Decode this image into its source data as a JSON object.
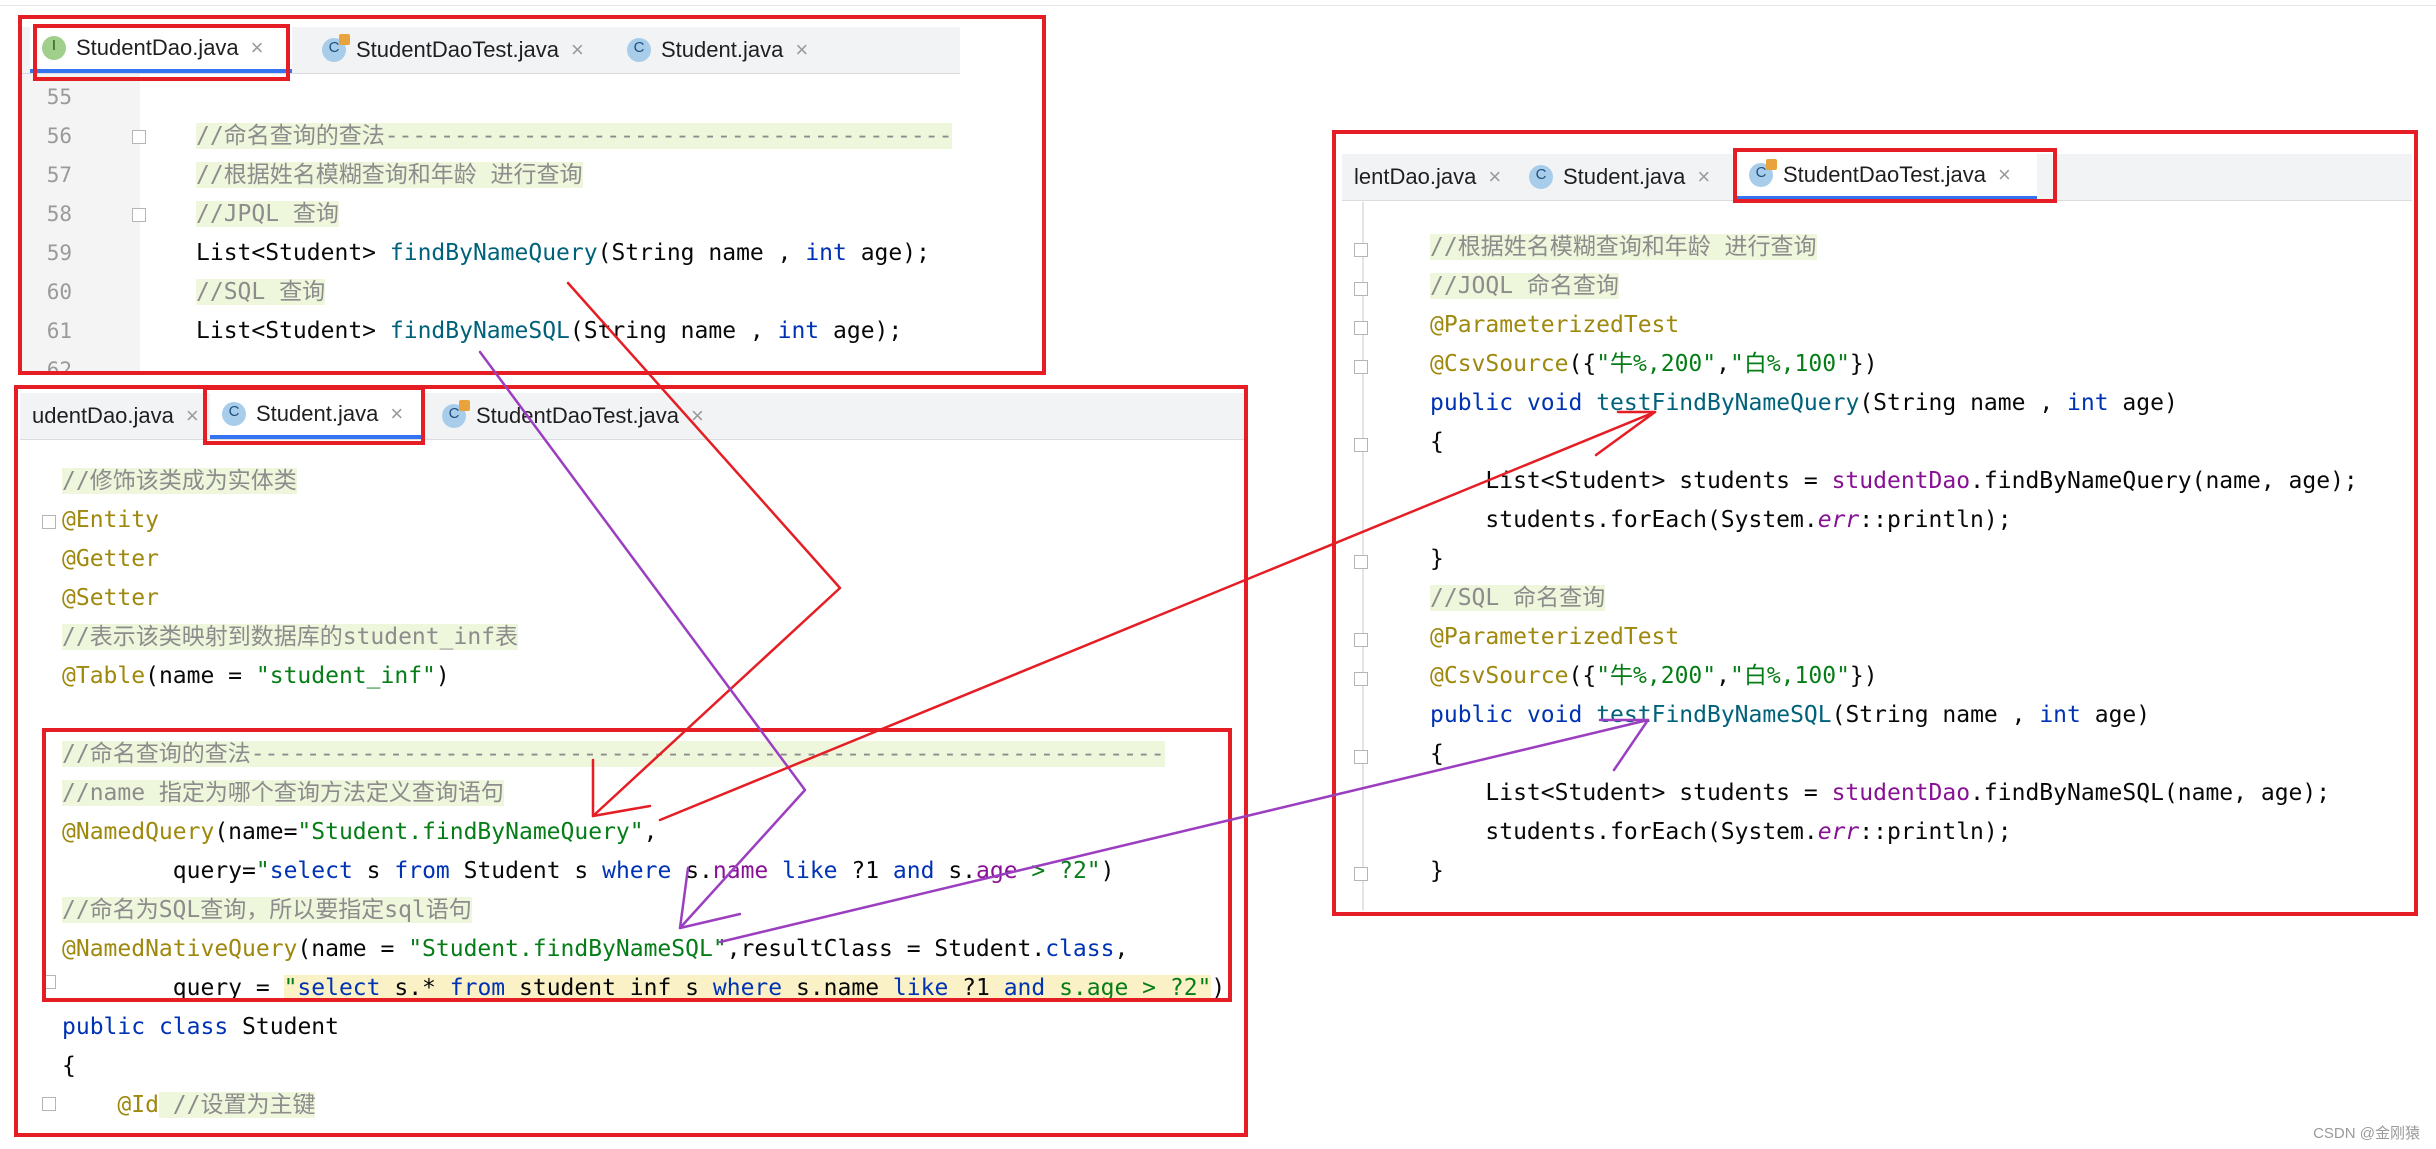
{
  "panel_a": {
    "tabs": [
      "StudentDao.java",
      "StudentDaoTest.java",
      "Student.java"
    ],
    "line_numbers": [
      "55",
      "56",
      "57",
      "58",
      "59",
      "60",
      "61",
      "62"
    ],
    "code": {
      "l56": "//命名查询的查法-----------------------------------------",
      "l57": "//根据姓名模糊查询和年龄 进行查询",
      "l58": "//JPQL 查询",
      "l59_a": "List<Student> ",
      "l59_b": "findByNameQuery",
      "l59_c": "(String name , ",
      "l59_d": "int",
      "l59_e": " age);",
      "l60": "//SQL 查询",
      "l61_a": "List<Student> ",
      "l61_b": "findByNameSQL",
      "l61_c": "(String name , ",
      "l61_d": "int",
      "l61_e": " age);"
    }
  },
  "panel_b": {
    "tabs": [
      "udentDao.java",
      "Student.java",
      "StudentDaoTest.java"
    ],
    "code": {
      "l1": "//修饰该类成为实体类",
      "l2": "@Entity",
      "l3": "@Getter",
      "l4": "@Setter",
      "l5": "//表示该类映射到数据库的student_inf表",
      "l6_a": "@Table",
      "l6_b": "(name = ",
      "l6_c": "\"student_inf\"",
      "l6_d": ")",
      "l8": "//命名查询的查法------------------------------------------------------------------",
      "l9": "//name 指定为哪个查询方法定义查询语句",
      "l10_a": "@NamedQuery",
      "l10_b": "(name=",
      "l10_c": "\"Student.findByNameQuery\"",
      "l10_d": ",",
      "l11_a": "        query=",
      "l11_b": "\"",
      "l11_c": "select",
      "l11_d": " s ",
      "l11_e": "from",
      "l11_f": " Student s ",
      "l11_g": "where",
      "l11_h": " s.",
      "l11_i": "name",
      "l11_j": " ",
      "l11_k": "like",
      "l11_l": " ?1 ",
      "l11_m": "and",
      "l11_n": " s.",
      "l11_o": "age",
      "l11_p": " > ?2\"",
      "l11_q": ")",
      "l12": "//命名为SQL查询，所以要指定sql语句",
      "l13_a": "@NamedNativeQuery",
      "l13_b": "(name = ",
      "l13_c": "\"Student.findByNameSQL\"",
      "l13_d": ",resultClass = Student.",
      "l13_e": "class",
      "l13_f": ",",
      "l14_a": "        query = ",
      "l14_b": "\"",
      "l14_c": "select",
      "l14_d": " s.* ",
      "l14_e": "from",
      "l14_f": " student_inf s ",
      "l14_g": "where",
      "l14_h": " s.name ",
      "l14_i": "like",
      "l14_j": " ?1 ",
      "l14_k": "and",
      "l14_l": " s.age > ?2\"",
      "l14_m": ")",
      "l15_a": "public",
      "l15_b": " ",
      "l15_c": "class",
      "l15_d": " Student",
      "l16": "{",
      "l17_a": "    @Id",
      "l17_b": " //设置为主键"
    }
  },
  "panel_c": {
    "tabs": [
      "lentDao.java",
      "Student.java",
      "StudentDaoTest.java"
    ],
    "code": {
      "l1": "//根据姓名模糊查询和年龄 进行查询",
      "l2": "//JOQL 命名查询",
      "l3": "@ParameterizedTest",
      "l4_a": "@CsvSource",
      "l4_b": "({",
      "l4_c": "\"牛%,200\"",
      "l4_d": ",",
      "l4_e": "\"白%,100\"",
      "l4_f": "})",
      "l5_a": "public",
      "l5_b": " ",
      "l5_c": "void",
      "l5_d": " ",
      "l5_e": "testFindByNameQuery",
      "l5_f": "(String name , ",
      "l5_g": "int",
      "l5_h": " age)",
      "l6": "{",
      "l7_a": "    List<Student> students = ",
      "l7_b": "studentDao",
      "l7_c": ".findByNameQuery(name, age);",
      "l8_a": "    students.forEach(System.",
      "l8_b": "err",
      "l8_c": "::println);",
      "l9": "}",
      "l10": "//SQL 命名查询",
      "l11": "@ParameterizedTest",
      "l12_a": "@CsvSource",
      "l12_b": "({",
      "l12_c": "\"牛%,200\"",
      "l12_d": ",",
      "l12_e": "\"白%,100\"",
      "l12_f": "})",
      "l13_a": "public",
      "l13_b": " ",
      "l13_c": "void",
      "l13_d": " ",
      "l13_e": "testFindByNameSQL",
      "l13_f": "(String name , ",
      "l13_g": "int",
      "l13_h": " age)",
      "l14": "{",
      "l15_a": "    List<Student> students = ",
      "l15_b": "studentDao",
      "l15_c": ".findByNameSQL(name, age);",
      "l16_a": "    students.forEach(System.",
      "l16_b": "err",
      "l16_c": "::println);",
      "l17": "}"
    }
  },
  "watermark": "CSDN @金刚猿",
  "colors": {
    "frame_red": "#e51e25",
    "arrow_red": "#e51e25",
    "arrow_purple": "#9b3fc0",
    "keyword": "#0033b3",
    "annotation": "#9e880d",
    "string": "#067d17",
    "comment": "#8c8c8c",
    "method": "#00627a",
    "field": "#871094"
  },
  "icons": [
    "interface-file-icon",
    "test-class-file-icon",
    "class-file-icon",
    "fold-marker-icon",
    "close-tab-icon"
  ]
}
